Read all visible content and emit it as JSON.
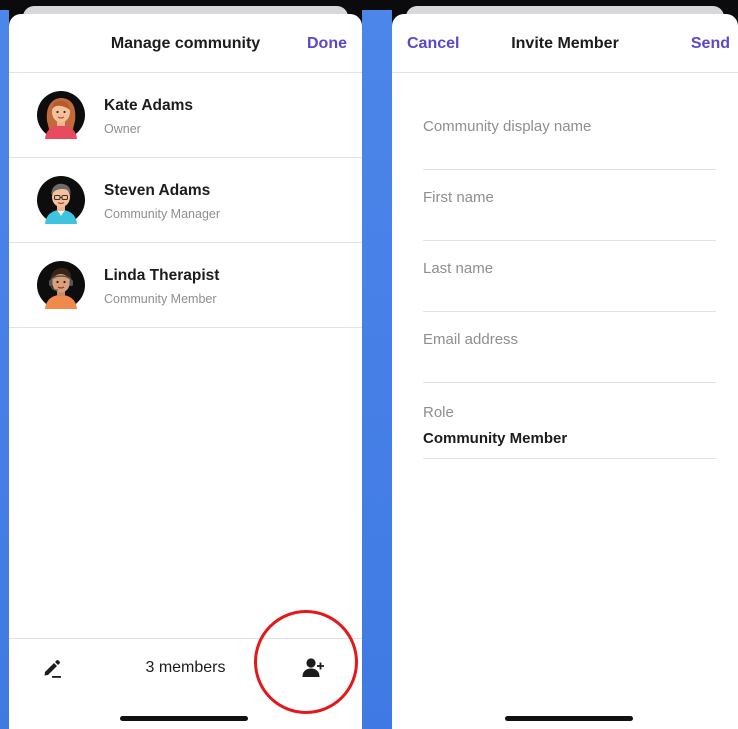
{
  "colors": {
    "accent": "#5b48c9",
    "backdrop": "#4a83e8",
    "annotation": "#e4181b",
    "secondary_text": "#8e8e93"
  },
  "manage_community": {
    "title": "Manage community",
    "done_label": "Done",
    "members": [
      {
        "name": "Kate Adams",
        "role": "Owner",
        "avatar": "woman-avatar-icon"
      },
      {
        "name": "Steven Adams",
        "role": "Community Manager",
        "avatar": "man-avatar-icon"
      },
      {
        "name": "Linda Therapist",
        "role": "Community Member",
        "avatar": "woman-headset-avatar-icon"
      }
    ],
    "bottom_bar": {
      "edit_icon": "pencil-icon",
      "member_count": "3 members",
      "add_icon": "add-person-icon"
    }
  },
  "invite_member": {
    "title": "Invite Member",
    "cancel_label": "Cancel",
    "send_label": "Send",
    "fields": {
      "display_name_placeholder": "Community display name",
      "first_name_placeholder": "First name",
      "last_name_placeholder": "Last name",
      "email_placeholder": "Email address"
    },
    "role": {
      "label": "Role",
      "value": "Community Member"
    }
  }
}
